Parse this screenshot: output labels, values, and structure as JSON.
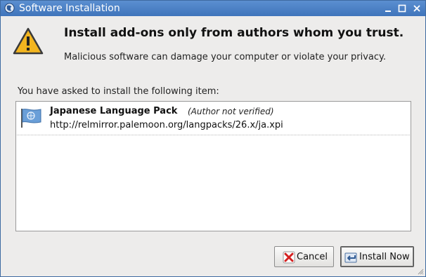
{
  "window": {
    "title": "Software Installation"
  },
  "warning": {
    "headline": "Install add-ons only from authors whom you trust.",
    "message": "Malicious software can damage your computer or violate your privacy."
  },
  "list": {
    "label": "You have asked to install the following item:",
    "items": [
      {
        "name": "Japanese Language Pack",
        "author": "(Author not verified)",
        "url": "http://relmirror.palemoon.org/langpacks/26.x/ja.xpi",
        "icon": "flag-icon"
      }
    ]
  },
  "buttons": {
    "cancel_label": "Cancel",
    "install_label": "Install Now"
  },
  "colors": {
    "titlebar": "#4a80c6",
    "warning": "#f3b51f"
  }
}
